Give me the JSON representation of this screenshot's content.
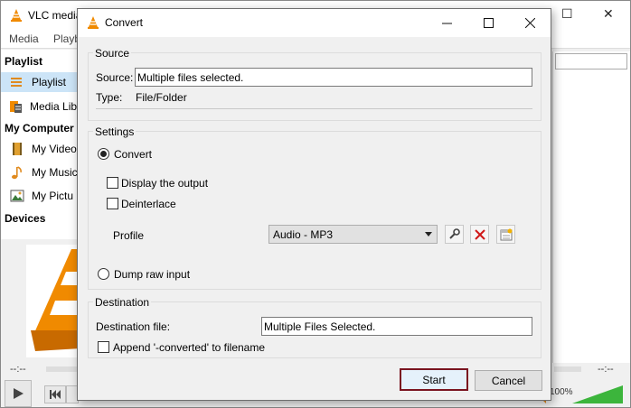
{
  "vlc": {
    "title": "VLC media",
    "menu": [
      "Media",
      "Playb"
    ],
    "sidebar": {
      "playlist_head": "Playlist",
      "playlist_items": [
        "Playlist",
        "Media Lib"
      ],
      "computer_head": "My Computer",
      "computer_items": [
        "My Video",
        "My Music",
        "My Pictu"
      ],
      "devices_head": "Devices"
    },
    "time_left": "--:--",
    "time_right": "--:--",
    "volume": "100%",
    "volume_level": 1.0
  },
  "dialog": {
    "title": "Convert",
    "source": {
      "group_title": "Source",
      "source_label": "Source:",
      "source_value": "Multiple files selected.",
      "type_label": "Type:",
      "type_value": "File/Folder"
    },
    "settings": {
      "group_title": "Settings",
      "convert_label": "Convert",
      "display_output_label": "Display the output",
      "deinterlace_label": "Deinterlace",
      "profile_label": "Profile",
      "profile_value": "Audio - MP3",
      "dump_raw_label": "Dump raw input"
    },
    "destination": {
      "group_title": "Destination",
      "file_label": "Destination file:",
      "file_value": "Multiple Files Selected.",
      "append_label": "Append '-converted' to filename"
    },
    "start_label": "Start",
    "cancel_label": "Cancel"
  },
  "colors": {
    "accent_border": "#7a1420",
    "selection": "#cce4f7",
    "vlc_orange": "#f08a00"
  }
}
